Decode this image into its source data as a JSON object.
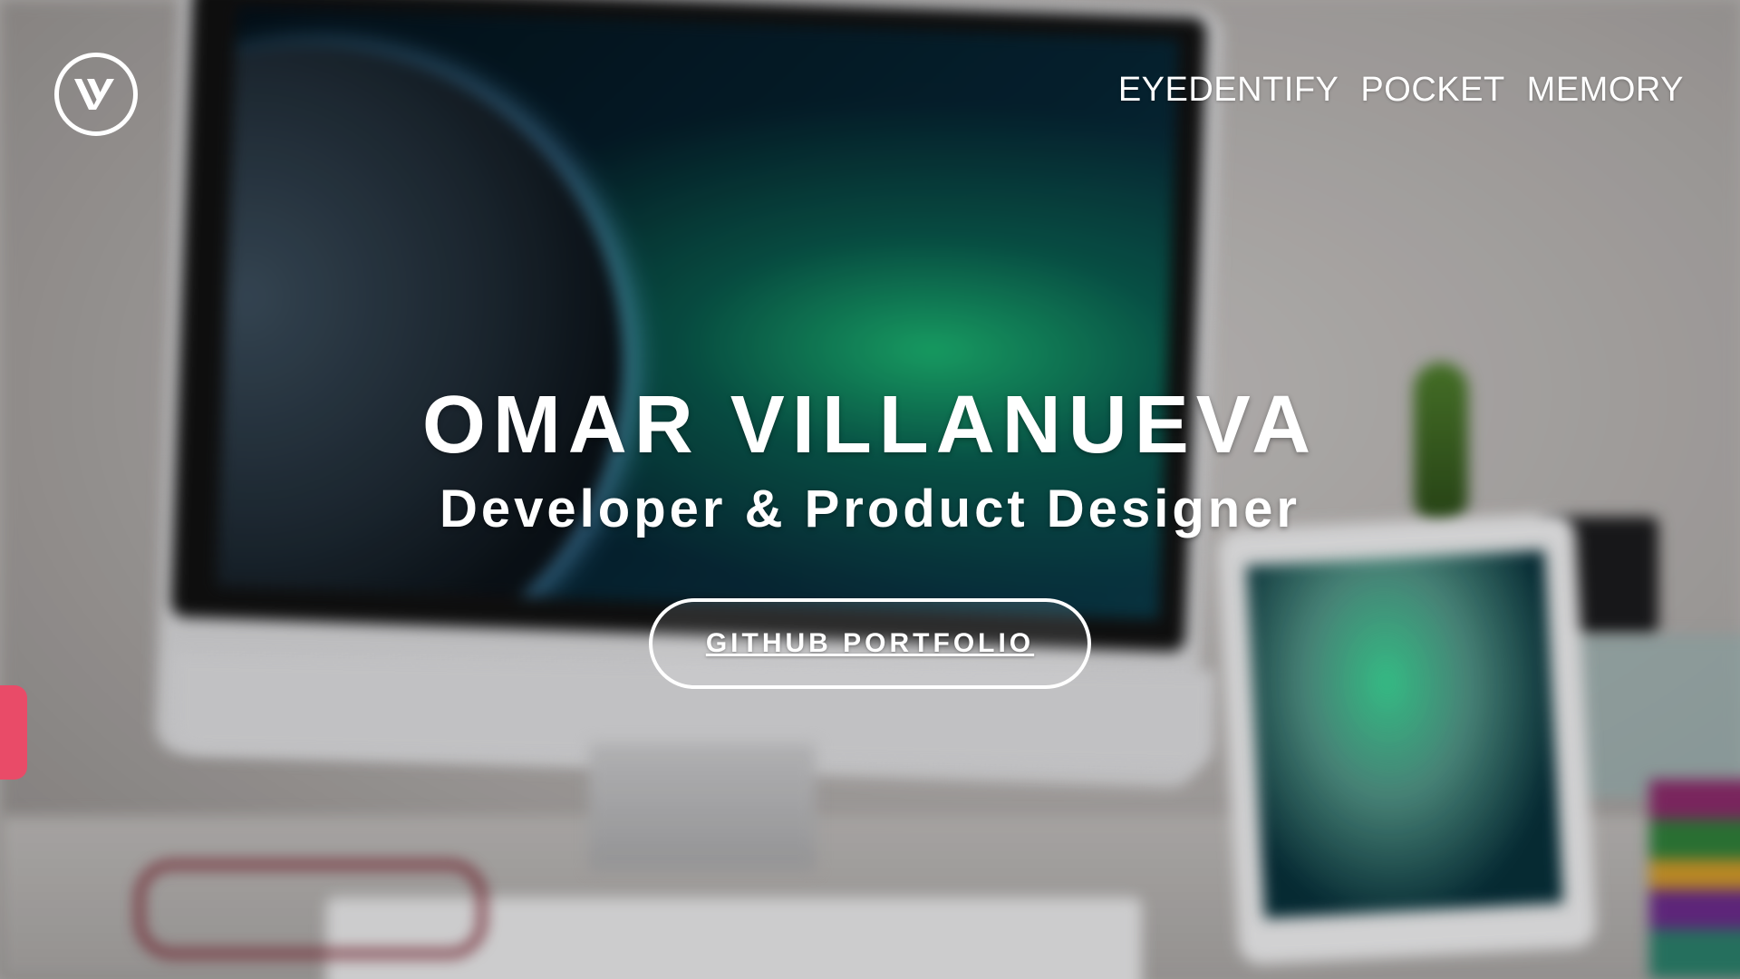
{
  "header": {
    "logo_icon": "villanueva-v-logo-icon",
    "nav": [
      {
        "label": "EYEDENTIFY"
      },
      {
        "label": "POCKET"
      },
      {
        "label": "MEMORY"
      }
    ]
  },
  "hero": {
    "title": "OMAR VILLANUEVA",
    "subtitle": "Developer & Product Designer",
    "cta_label": "GITHUB PORTFOLIO"
  },
  "colors": {
    "text": "#ffffff",
    "side_tab": "#e94b68"
  }
}
